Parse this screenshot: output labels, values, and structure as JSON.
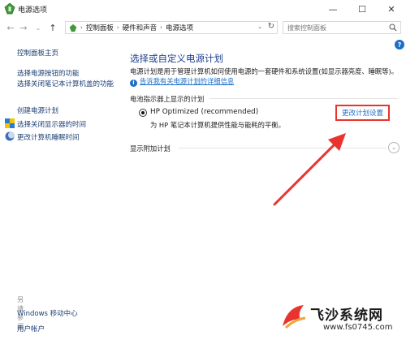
{
  "window": {
    "title": "电源选项",
    "minimize": "—",
    "maximize": "☐",
    "close": "✕"
  },
  "address": {
    "breadcrumbs": [
      "控制面板",
      "硬件和声音",
      "电源选项"
    ],
    "search_placeholder": "搜索控制面板"
  },
  "sidebar": {
    "home": "控制面板主页",
    "links": [
      "选择电源按钮的功能",
      "选择关闭笔记本计算机盖的功能",
      "创建电源计划",
      "选择关闭显示器的时间",
      "更改计算机睡眠时间"
    ],
    "see_also_label": "另请参阅",
    "see_also": [
      "Windows 移动中心",
      "用户帐户"
    ]
  },
  "main": {
    "title": "选择或自定义电源计划",
    "description": "电源计划是用于管理计算机如何使用电源的一套硬件和系统设置(如显示器亮度、睡眠等)。",
    "learn_more": "告诉我有关电源计划的详细信息",
    "battery_group_label": "电池指示器上显示的计划",
    "plan": {
      "name": "HP Optimized (recommended)",
      "description": "为 HP 笔记本计算机提供性能与能耗的平衡。",
      "change_link": "更改计划设置",
      "selected": true
    },
    "more_plans_label": "显示附加计划"
  },
  "watermark": {
    "name": "飞沙系统网",
    "url": "www.fs0745.com"
  },
  "colors": {
    "link": "#1c6ec9",
    "title": "#1d3f8f",
    "sidebar_link": "#1c3f73",
    "highlight": "#e8342c"
  },
  "icons": [
    "power-options-icon",
    "back-arrow-icon",
    "forward-arrow-icon",
    "up-arrow-icon",
    "search-icon",
    "help-icon",
    "shield-icon",
    "moon-icon",
    "expand-chevron-icon"
  ]
}
